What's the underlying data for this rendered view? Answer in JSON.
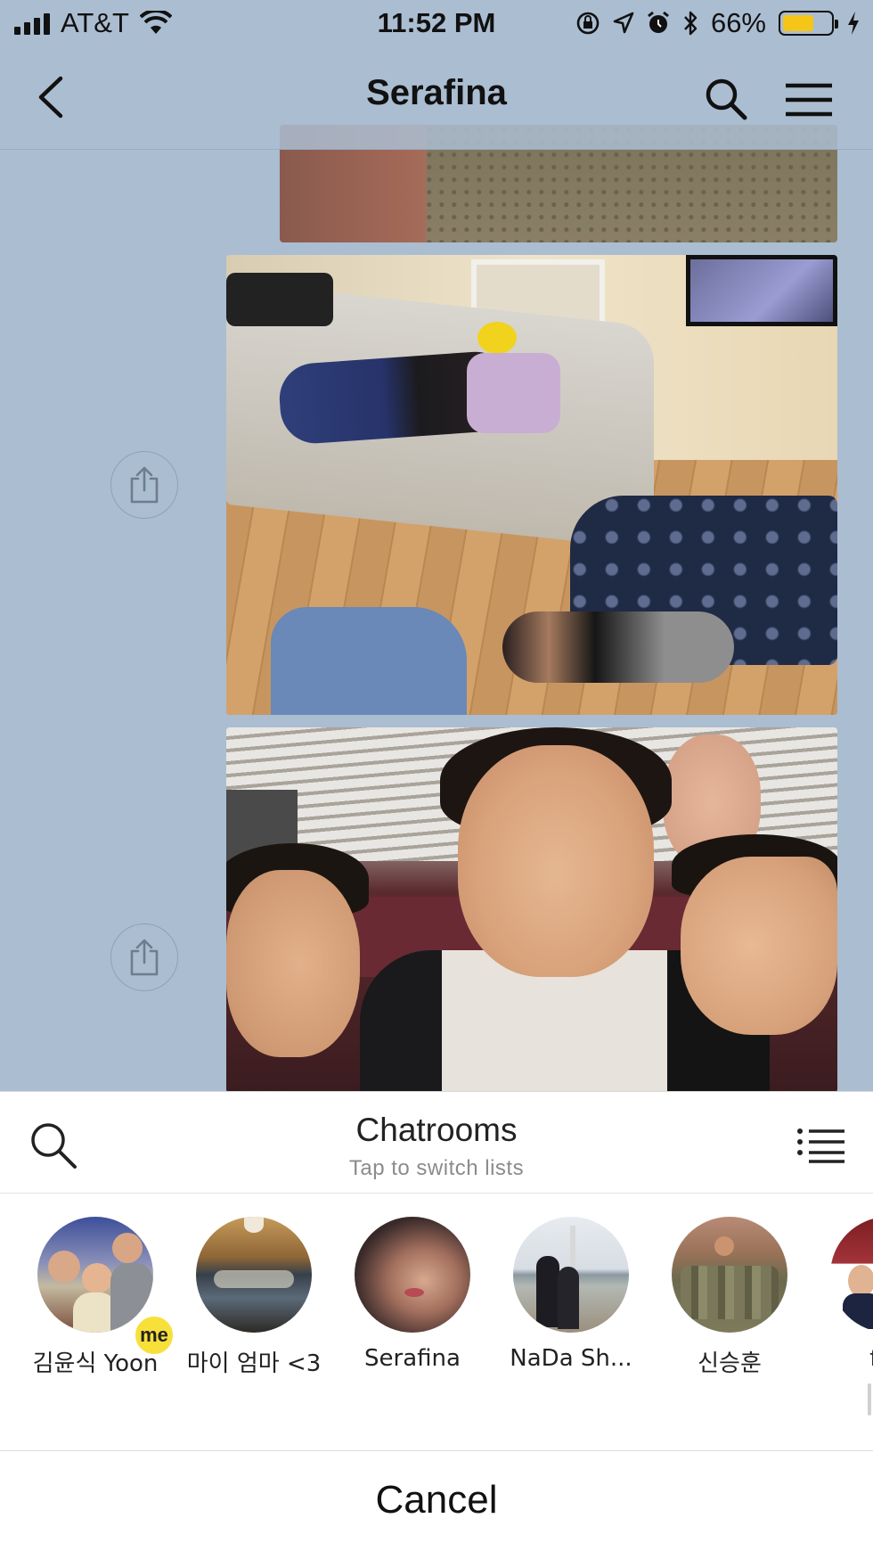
{
  "status_bar": {
    "carrier": "AT&T",
    "time": "11:52 PM",
    "battery_percent": "66%",
    "battery_level": 0.66,
    "battery_color": "#f5c518",
    "icons": [
      "signal-icon",
      "wifi-icon",
      "orientation-lock-icon",
      "location-icon",
      "alarm-icon",
      "bluetooth-icon",
      "battery-icon",
      "charging-icon"
    ]
  },
  "nav": {
    "title": "Serafina",
    "icons": [
      "back-chevron-icon",
      "search-icon",
      "hamburger-menu-icon"
    ]
  },
  "messages": [
    {
      "type": "photo",
      "description_icon": "photo-outdoor"
    },
    {
      "type": "photo",
      "share_icon": "share-icon"
    },
    {
      "type": "photo",
      "share_icon": "share-icon"
    }
  ],
  "sheet": {
    "title": "Chatrooms",
    "subtitle": "Tap to switch lists",
    "icons": [
      "search-icon",
      "list-icon"
    ],
    "rooms": [
      {
        "label": "김윤식 Yoon",
        "badge": "me"
      },
      {
        "label": "마이 엄마 <3"
      },
      {
        "label": "Serafina"
      },
      {
        "label": "NaDa Sh..."
      },
      {
        "label": "신승훈"
      },
      {
        "label": "fan"
      }
    ],
    "cancel_label": "Cancel"
  },
  "colors": {
    "chat_background": "#abbdd0",
    "me_badge": "#f7e03a"
  }
}
